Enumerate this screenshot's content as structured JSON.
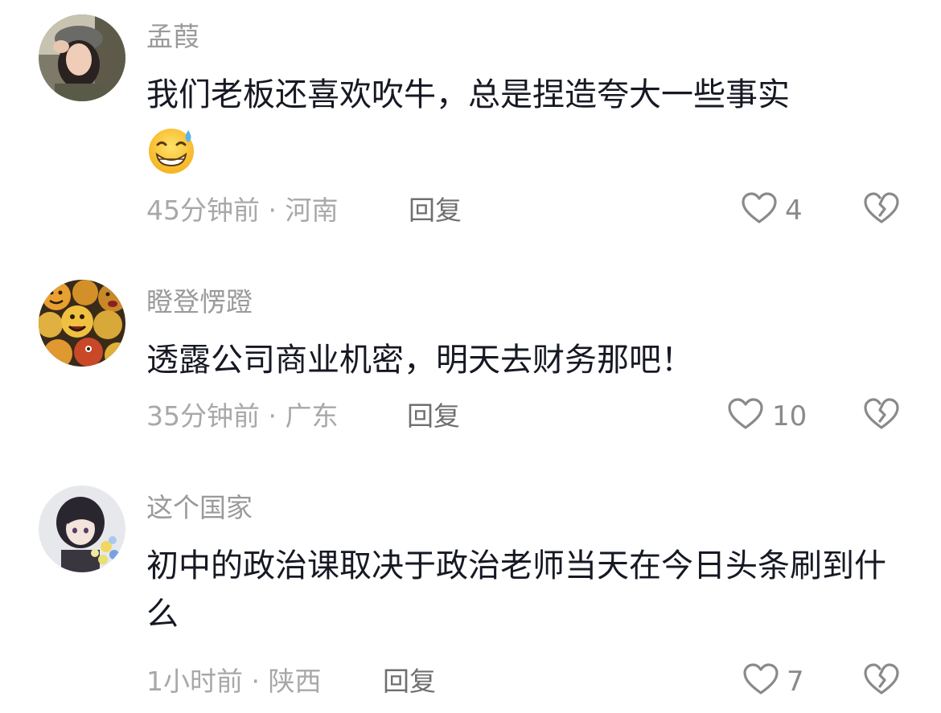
{
  "comments": [
    {
      "username": "孟葭",
      "content": "我们老板还喜欢吹牛，总是捏造夸大一些事实",
      "emoji": "sweat-grin-emoji",
      "time": "45分钟前",
      "separator": "·",
      "location": "河南",
      "reply_label": "回复",
      "likes": "4"
    },
    {
      "username": "瞪登愣蹬",
      "content": "透露公司商业机密，明天去财务那吧！",
      "time": "35分钟前",
      "separator": "·",
      "location": "广东",
      "reply_label": "回复",
      "likes": "10"
    },
    {
      "username": "这个国家",
      "content": "初中的政治课取决于政治老师当天在今日头条刷到什么",
      "time": "1小时前",
      "separator": "·",
      "location": "陕西",
      "reply_label": "回复",
      "likes": "7"
    }
  ],
  "icons": {
    "like": "heart-outline-icon",
    "dislike": "broken-heart-icon"
  },
  "colors": {
    "text": "#161823",
    "meta": "#a8a8a8",
    "username": "#9a9a9a",
    "icon": "#8a8a8a"
  }
}
